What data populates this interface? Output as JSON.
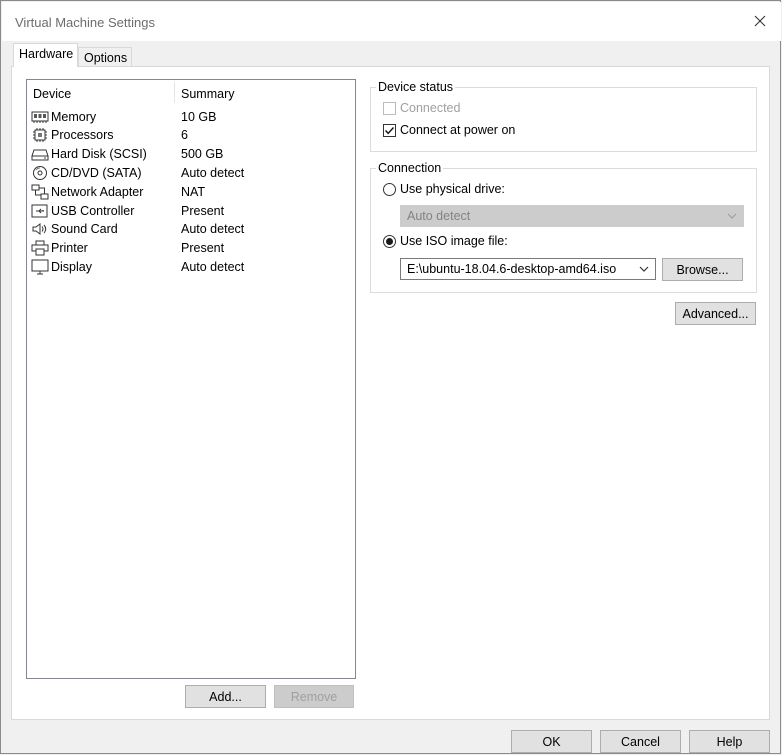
{
  "window": {
    "title": "Virtual Machine Settings"
  },
  "tabs": [
    {
      "label": "Hardware",
      "active": true
    },
    {
      "label": "Options",
      "active": false
    }
  ],
  "device_list": {
    "columns": [
      "Device",
      "Summary"
    ],
    "rows": [
      {
        "device": "Memory",
        "summary": "10 GB",
        "icon": "memory-icon"
      },
      {
        "device": "Processors",
        "summary": "6",
        "icon": "processor-icon"
      },
      {
        "device": "Hard Disk (SCSI)",
        "summary": "500 GB",
        "icon": "hard-disk-icon"
      },
      {
        "device": "CD/DVD (SATA)",
        "summary": "Auto detect",
        "icon": "cd-dvd-icon"
      },
      {
        "device": "Network Adapter",
        "summary": "NAT",
        "icon": "network-adapter-icon"
      },
      {
        "device": "USB Controller",
        "summary": "Present",
        "icon": "usb-icon"
      },
      {
        "device": "Sound Card",
        "summary": "Auto detect",
        "icon": "speaker-icon"
      },
      {
        "device": "Printer",
        "summary": "Present",
        "icon": "printer-icon"
      },
      {
        "device": "Display",
        "summary": "Auto detect",
        "icon": "display-icon"
      }
    ],
    "add_label": "Add...",
    "remove_label": "Remove"
  },
  "device_status": {
    "title": "Device status",
    "connected_label": "Connected",
    "connected_checked": false,
    "connect_at_power_on_label": "Connect at power on",
    "connect_at_power_on_checked": true
  },
  "connection": {
    "title": "Connection",
    "physical_label": "Use physical drive:",
    "physical_selected": false,
    "physical_value": "Auto detect",
    "iso_label": "Use ISO image file:",
    "iso_selected": true,
    "iso_value": "E:\\ubuntu-18.04.6-desktop-amd64.iso",
    "browse_label": "Browse..."
  },
  "advanced_label": "Advanced...",
  "footer": {
    "ok_label": "OK",
    "cancel_label": "Cancel",
    "help_label": "Help"
  }
}
